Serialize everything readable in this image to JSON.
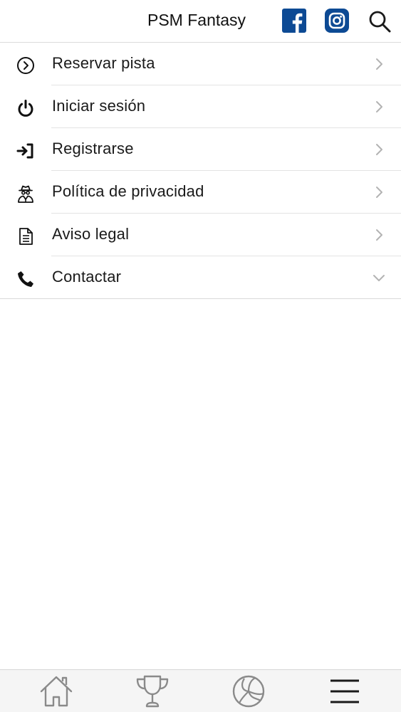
{
  "header": {
    "title": "PSM Fantasy",
    "icons": [
      "facebook-icon",
      "instagram-icon",
      "search-icon"
    ],
    "brand_color": "#0d4a94"
  },
  "menu": {
    "items": [
      {
        "label": "Reservar pista",
        "icon": "circle-chevron-right-icon",
        "indicator": "chevron-right"
      },
      {
        "label": "Iniciar sesión",
        "icon": "power-icon",
        "indicator": "chevron-right"
      },
      {
        "label": "Registrarse",
        "icon": "sign-in-icon",
        "indicator": "chevron-right"
      },
      {
        "label": "Política de privacidad",
        "icon": "user-secret-icon",
        "indicator": "chevron-right"
      },
      {
        "label": "Aviso legal",
        "icon": "document-icon",
        "indicator": "chevron-right"
      },
      {
        "label": "Contactar",
        "icon": "phone-icon",
        "indicator": "chevron-down"
      }
    ]
  },
  "tabbar": {
    "tabs": [
      {
        "icon": "home-icon"
      },
      {
        "icon": "trophy-icon"
      },
      {
        "icon": "volleyball-icon"
      },
      {
        "icon": "hamburger-menu-icon"
      }
    ]
  }
}
